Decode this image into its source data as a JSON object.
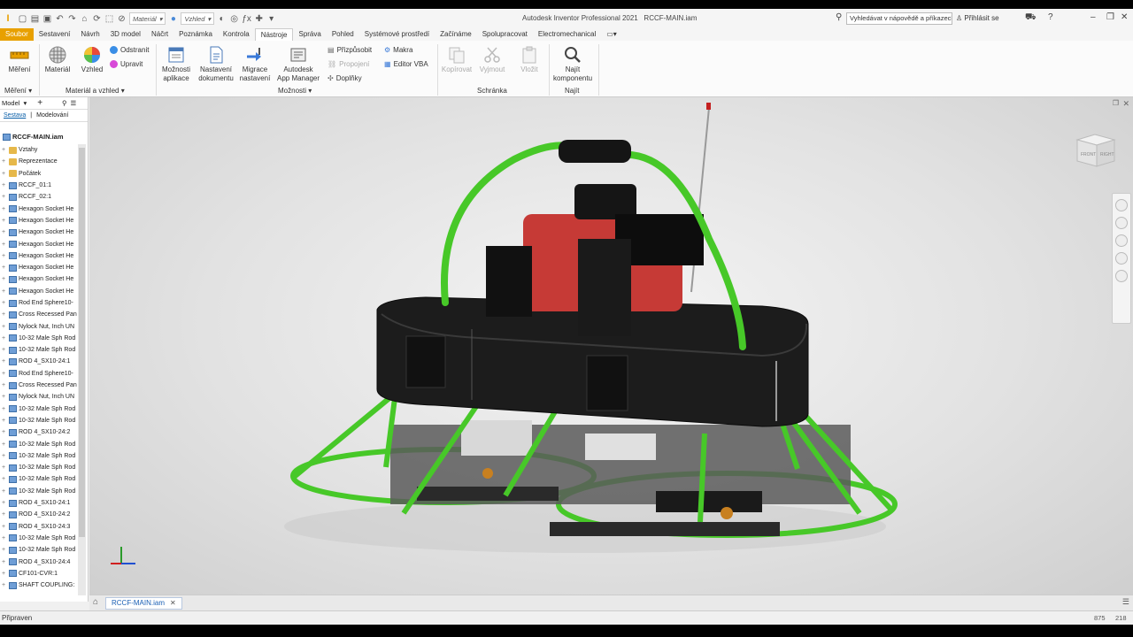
{
  "titlebar": {
    "material_combo": "Materiál",
    "appearance_combo": "Vzhled",
    "app_title": "Autodesk Inventor Professional 2021",
    "doc_title": "RCCF-MAIN.iam",
    "help_search": "Vyhledávat v nápovědě a příkazech",
    "sign_in": "Přihlásit se"
  },
  "tabs": [
    "Soubor",
    "Sestavení",
    "Návrh",
    "3D model",
    "Náčrt",
    "Poznámka",
    "Kontrola",
    "Nástroje",
    "Správa",
    "Pohled",
    "Systémové prostředí",
    "Začínáme",
    "Spolupracovat",
    "Electromechanical"
  ],
  "active_tab": "Nástroje",
  "ribbon": {
    "measure": "Měření",
    "material": "Materiál",
    "appearance": "Vzhled",
    "remove": "Odstranit",
    "edit": "Upravit",
    "app_options_1": "Možnosti",
    "app_options_2": "aplikace",
    "doc_settings_1": "Nastavení",
    "doc_settings_2": "dokumentu",
    "migrate_1": "Migrace",
    "migrate_2": "nastavení",
    "appmanager_1": "Autodesk",
    "appmanager_2": "App Manager",
    "customize": "Přizpůsobit",
    "links": "Propojení",
    "addins": "Doplňky",
    "macros": "Makra",
    "vba": "Editor VBA",
    "copy": "Kopírovat",
    "cut": "Vyjmout",
    "paste": "Vložit",
    "find_1": "Najít",
    "find_2": "komponentu",
    "grp_measure": "Měření",
    "grp_material": "Materiál a vzhled",
    "grp_options": "Možnosti",
    "grp_clipboard": "Schránka",
    "grp_find": "Najít"
  },
  "panel": {
    "title": "Model",
    "tab_assembly": "Sestava",
    "tab_modeling": "Modelování",
    "root": "RCCF-MAIN.iam",
    "items": [
      {
        "label": "Vztahy",
        "type": "folder"
      },
      {
        "label": "Reprezentace",
        "type": "folder"
      },
      {
        "label": "Počátek",
        "type": "folder"
      },
      {
        "label": "RCCF_01:1",
        "type": "part"
      },
      {
        "label": "RCCF_02:1",
        "type": "part"
      },
      {
        "label": "Hexagon Socket He",
        "type": "part"
      },
      {
        "label": "Hexagon Socket He",
        "type": "part"
      },
      {
        "label": "Hexagon Socket He",
        "type": "part"
      },
      {
        "label": "Hexagon Socket He",
        "type": "part"
      },
      {
        "label": "Hexagon Socket He",
        "type": "part"
      },
      {
        "label": "Hexagon Socket He",
        "type": "part"
      },
      {
        "label": "Hexagon Socket He",
        "type": "part"
      },
      {
        "label": "Hexagon Socket He",
        "type": "part"
      },
      {
        "label": "Rod End Sphere10-",
        "type": "part"
      },
      {
        "label": "Cross Recessed Pan",
        "type": "part"
      },
      {
        "label": "Nylock Nut, Inch UN",
        "type": "part"
      },
      {
        "label": "10-32 Male Sph Rod",
        "type": "part"
      },
      {
        "label": "10-32 Male Sph Rod",
        "type": "part"
      },
      {
        "label": "ROD 4_SX10-24:1",
        "type": "part"
      },
      {
        "label": "Rod End Sphere10-",
        "type": "part"
      },
      {
        "label": "Cross Recessed Pan",
        "type": "part"
      },
      {
        "label": "Nylock Nut, Inch UN",
        "type": "part"
      },
      {
        "label": "10-32 Male Sph Rod",
        "type": "part"
      },
      {
        "label": "10-32 Male Sph Rod",
        "type": "part"
      },
      {
        "label": "ROD 4_SX10-24:2",
        "type": "part"
      },
      {
        "label": "10-32 Male Sph Rod",
        "type": "part"
      },
      {
        "label": "10-32 Male Sph Rod",
        "type": "part"
      },
      {
        "label": "10-32 Male Sph Rod",
        "type": "part"
      },
      {
        "label": "10-32 Male Sph Rod",
        "type": "part"
      },
      {
        "label": "10-32 Male Sph Rod",
        "type": "part"
      },
      {
        "label": "ROD 4_SX10-24:1",
        "type": "part"
      },
      {
        "label": "ROD 4_SX10-24:2",
        "type": "part"
      },
      {
        "label": "ROD 4_SX10-24:3",
        "type": "part"
      },
      {
        "label": "10-32 Male Sph Rod",
        "type": "part"
      },
      {
        "label": "10-32 Male Sph Rod",
        "type": "part"
      },
      {
        "label": "ROD 4_SX10-24:4",
        "type": "part"
      },
      {
        "label": "CF101-CVR:1",
        "type": "part"
      },
      {
        "label": "SHAFT COUPLING:",
        "type": "part"
      }
    ]
  },
  "viewcube": {
    "front": "FRONT",
    "right": "RIGHT"
  },
  "doc_tab": "RCCF-MAIN.iam",
  "status": {
    "left": "Připraven",
    "count1": "875",
    "count2": "218"
  },
  "colors": {
    "accent": "#e8a000",
    "frame": "#47c828",
    "body": "#1a1a1a",
    "engine": "#c63a36"
  }
}
